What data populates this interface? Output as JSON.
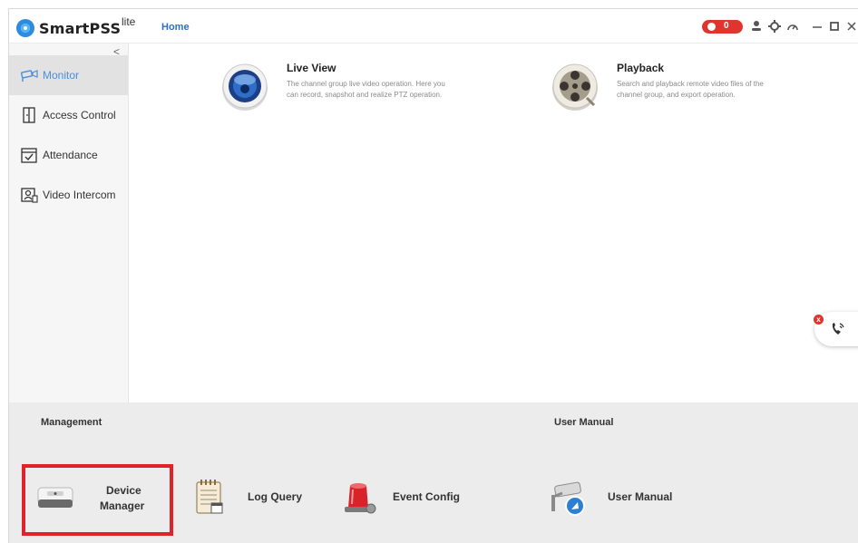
{
  "titlebar": {
    "brand": "SmartPSS",
    "brand_sup": "lite",
    "home_tab": "Home",
    "alarm_count": "0",
    "icons": [
      "speaker-icon",
      "user-icon",
      "settings-icon",
      "dashboard-icon",
      "minimize-icon",
      "maximize-icon",
      "close-icon"
    ]
  },
  "sidebar": {
    "collapse_glyph": "<",
    "items": [
      {
        "label": "Monitor",
        "icon": "monitor-camera-icon",
        "active": true
      },
      {
        "label": "Access Control",
        "icon": "door-icon",
        "active": false
      },
      {
        "label": "Attendance",
        "icon": "calendar-check-icon",
        "active": false
      },
      {
        "label": "Video Intercom",
        "icon": "intercom-icon",
        "active": false
      }
    ]
  },
  "main": {
    "features": [
      {
        "title": "Live View",
        "desc": "The channel group live video operation. Here you can record, snapshot and realize PTZ operation.",
        "icon": "live-view-lens-icon"
      },
      {
        "title": "Playback",
        "desc": "Search and playback remote video files of the channel group, and export operation.",
        "icon": "film-reel-icon"
      }
    ],
    "call_widget": {
      "icon": "phone-call-icon",
      "close_glyph": "x"
    }
  },
  "management": {
    "title": "Management",
    "tools": [
      {
        "label_line1": "Device",
        "label_line2": "Manager",
        "icon": "device-manager-icon",
        "highlighted": true
      },
      {
        "label": "Log Query",
        "icon": "log-notepad-icon"
      },
      {
        "label": "Event Config",
        "icon": "alarm-light-icon"
      }
    ]
  },
  "user_manual": {
    "title": "User Manual",
    "tool": {
      "label": "User Manual",
      "icon": "manual-camera-icon"
    }
  },
  "colors": {
    "accent_blue": "#2b6fc6",
    "active_nav_text": "#4a8ee0",
    "alarm_red": "#e0352f",
    "highlight_red": "#e0232b",
    "management_bg": "#ececec"
  }
}
